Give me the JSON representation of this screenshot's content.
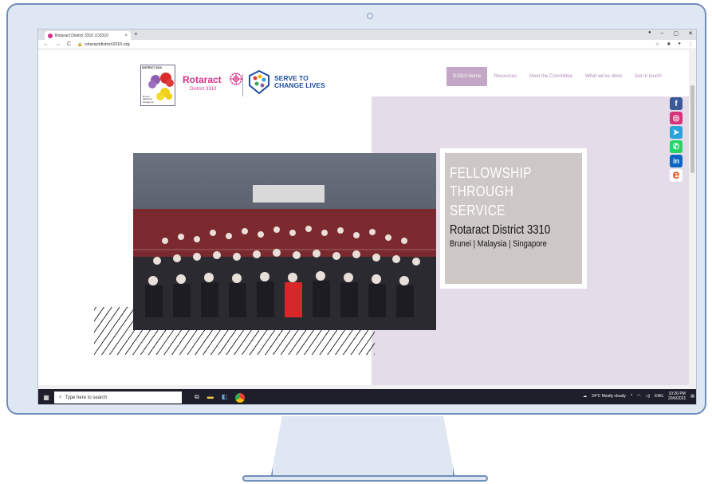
{
  "browser": {
    "tab_title": "Rotaract District 3310 | D3310",
    "tab_close": "×",
    "new_tab": "+",
    "url": "rotaractdistrict3310.org",
    "window_controls": [
      "–",
      "▢",
      "✕"
    ],
    "nav": [
      "←",
      "→",
      "C"
    ]
  },
  "header": {
    "logo_caption": "DISTRICT 3310",
    "logo_subtitle": "Brunei Malaysia Singapore",
    "brand": "Rotaract",
    "brand_sub": "District 3310",
    "theme_line1": "SERVE TO",
    "theme_line2": "CHANGE LIVES"
  },
  "menu": {
    "items": [
      {
        "label": "D3310 Home",
        "active": true
      },
      {
        "label": "Resources",
        "active": false
      },
      {
        "label": "Meet the Committee",
        "active": false
      },
      {
        "label": "What we've done",
        "active": false
      },
      {
        "label": "Get in touch!",
        "active": false
      }
    ]
  },
  "social": [
    {
      "name": "facebook-icon",
      "glyph": "f",
      "color": "#3b5998"
    },
    {
      "name": "instagram-icon",
      "glyph": "◎",
      "color": "#d6337a"
    },
    {
      "name": "telegram-icon",
      "glyph": "➤",
      "color": "#2aa3dd"
    },
    {
      "name": "whatsapp-icon",
      "glyph": "✆",
      "color": "#25d366"
    },
    {
      "name": "linkedin-icon",
      "glyph": "in",
      "color": "#0a66c2"
    },
    {
      "name": "edge-e-icon",
      "glyph": "e",
      "color": "#e94e1b"
    }
  ],
  "hero": {
    "line1": "FELLOWSHIP",
    "line2": "THROUGH",
    "line3": "SERVICE",
    "name": "Rotaract District 3310",
    "countries": "Brunei | Malaysia | Singapore"
  },
  "taskbar": {
    "search_placeholder": "Type here to search",
    "weather": "24°C  Mostly cloudy",
    "lang": "ENG",
    "time": "10:26 PM",
    "date": "20/6/2021"
  },
  "colors": {
    "accent": "#d6338b",
    "menu_active": "#c4a7c6",
    "lilac_bg": "#e4dde9",
    "theme_blue": "#1f4fa0"
  }
}
